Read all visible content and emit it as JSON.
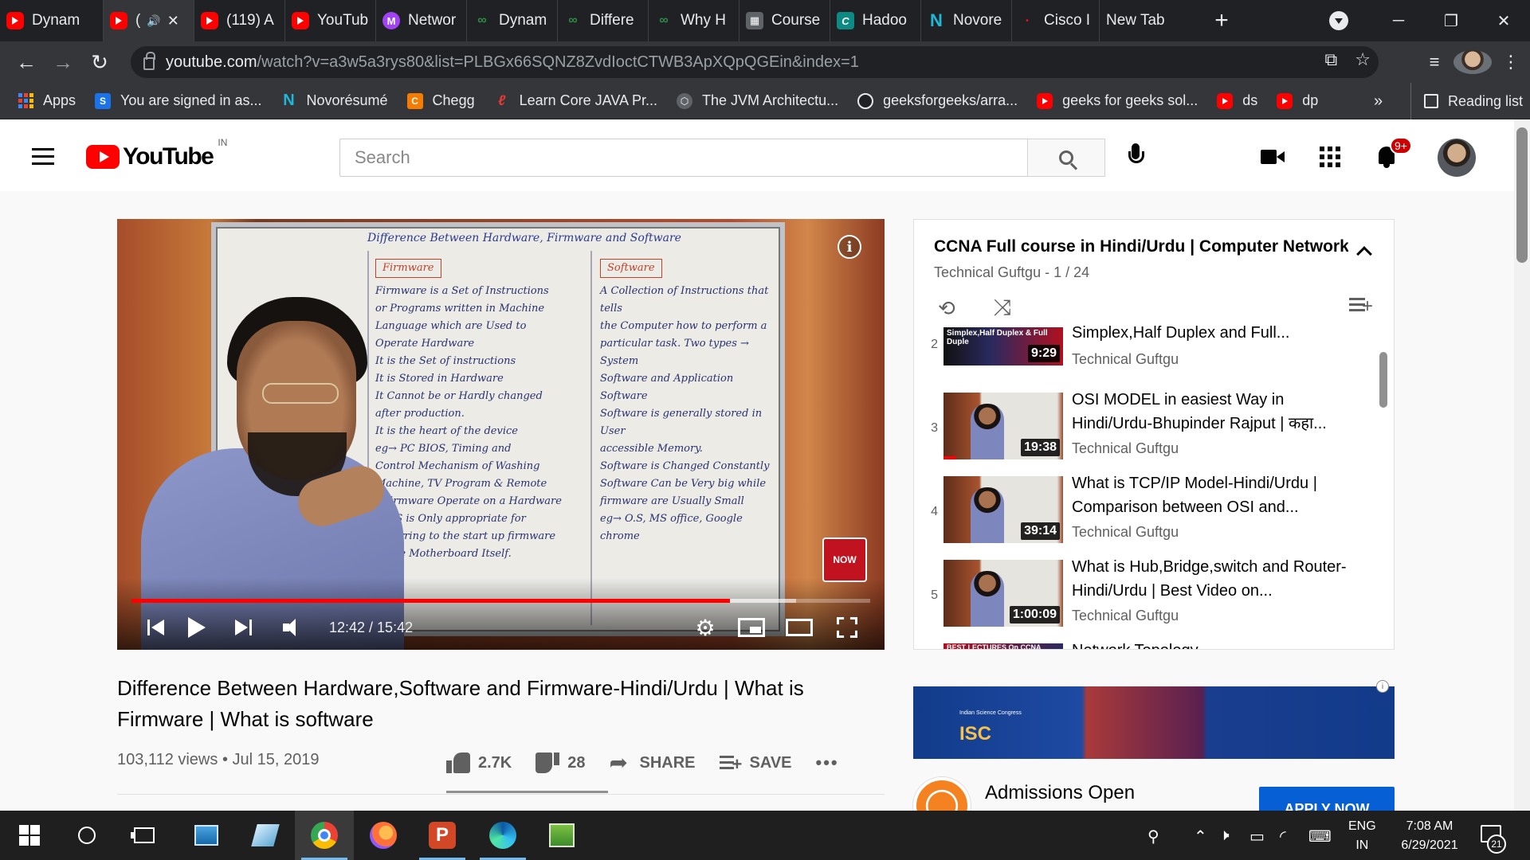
{
  "browser": {
    "tabs": [
      {
        "label": "Dynam",
        "icon": "youtube-icon"
      },
      {
        "label": "(",
        "icon": "youtube-icon",
        "active": true,
        "audio": "audio-icon"
      },
      {
        "label": "(119) A",
        "icon": "youtube-icon"
      },
      {
        "label": "YouTub",
        "icon": "youtube-icon"
      },
      {
        "label": "Networ",
        "icon": "mathpix-icon"
      },
      {
        "label": "Dynam",
        "icon": "gfg-icon"
      },
      {
        "label": "Differe",
        "icon": "gfg-icon"
      },
      {
        "label": "Why H",
        "icon": "gfg-icon"
      },
      {
        "label": "Course",
        "icon": "course-icon"
      },
      {
        "label": "Hadoo",
        "icon": "chegg-icon"
      },
      {
        "label": "Novore",
        "icon": "novoresume-icon"
      },
      {
        "label": "Cisco I",
        "icon": "cisco-icon"
      },
      {
        "label": "New Tab",
        "icon": ""
      }
    ],
    "url_host": "youtube.com",
    "url_path": "/watch?v=a3w5a3rys80&list=PLBGx66SQNZ8ZvdIoctCTWB3ApXQpQGEin&index=1",
    "bookmarks": [
      {
        "label": "Apps",
        "icon": "apps-icon"
      },
      {
        "label": "You are signed in as...",
        "icon": "s-icon"
      },
      {
        "label": "Novorésumé",
        "icon": "novoresume-icon"
      },
      {
        "label": "Chegg",
        "icon": "chegg-icon"
      },
      {
        "label": "Learn Core JAVA Pr...",
        "icon": "learn-java-icon"
      },
      {
        "label": "The JVM Architectu...",
        "icon": "jvm-icon"
      },
      {
        "label": "geeksforgeeks/arra...",
        "icon": "github-icon"
      },
      {
        "label": "geeks for geeks sol...",
        "icon": "youtube-icon"
      },
      {
        "label": "ds",
        "icon": "youtube-icon"
      },
      {
        "label": "dp",
        "icon": "youtube-icon"
      }
    ],
    "bookmarks_more": "»",
    "reading_list": "Reading list"
  },
  "youtube": {
    "logo_text": "YouTube",
    "region": "IN",
    "search_placeholder": "Search",
    "notification_count": "9+",
    "player": {
      "time": "12:42 / 15:42",
      "progress_fraction": 0.81,
      "buffered_fraction": 0.9,
      "info_glyph": "i",
      "subscribe_badge": "NOW",
      "whiteboard": {
        "title": "Difference Between Hardware, Firmware and Software",
        "firmware_heading": "Firmware",
        "software_heading": "Software",
        "firmware_lines": [
          "Firmware is a Set of Instructions",
          "or Programs written in Machine",
          "Language which are Used to",
          "Operate Hardware",
          "It is the Set of instructions",
          "It is Stored in Hardware",
          "It Cannot be or Hardly changed",
          "after production.",
          "It is the heart of the device",
          "eg→ PC BIOS, Timing and",
          "Control Mechanism of Washing",
          "Machine, TV Program & Remote",
          "A firmware Operate on a Hardware",
          "BIOS is Only appropriate for",
          "Referring to the start up firmware",
          "of the Motherboard Itself."
        ],
        "software_lines": [
          "A Collection of Instructions that tells",
          "the Computer how to perform a",
          "particular task. Two types → System",
          "Software and Application Software",
          "Software is generally stored in User",
          "accessible Memory.",
          "Software is Changed Constantly",
          "Software Can be Very big while",
          "firmware are Usually Small",
          "eg→ O.S, MS office, Google chrome"
        ]
      }
    },
    "video": {
      "title": "Difference Between Hardware,Software and Firmware-Hindi/Urdu | What is Firmware | What is software",
      "views": "103,112 views",
      "date": "Jul 15, 2019",
      "likes": "2.7K",
      "dislikes": "28",
      "share": "SHARE",
      "save": "SAVE",
      "more": "•••"
    },
    "playlist": {
      "title": "CCNA Full course in Hindi/Urdu | Computer Networking",
      "channel": "Technical Guftgu",
      "position": "1 / 24",
      "items": [
        {
          "index": "2",
          "title": "Simplex,Half Duplex and Full...",
          "channel": "Technical Guftgu",
          "duration": "9:29",
          "thumb_text": "Simplex,Half Duplex & Full Duple"
        },
        {
          "index": "3",
          "title": "OSI MODEL in easiest Way in Hindi/Urdu-Bhupinder Rajput | कहा...",
          "channel": "Technical Guftgu",
          "duration": "19:38",
          "watched": true
        },
        {
          "index": "4",
          "title": "What is TCP/IP Model-Hindi/Urdu | Comparison between OSI and...",
          "channel": "Technical Guftgu",
          "duration": "39:14"
        },
        {
          "index": "5",
          "title": "What is Hub,Bridge,switch and Router-Hindi/Urdu | Best Video on...",
          "channel": "Technical Guftgu",
          "duration": "1:00:09"
        },
        {
          "index": "",
          "title": "Network Topology-",
          "channel": "",
          "duration": "",
          "thumb_text": "BEST LECTURES On CCNA"
        }
      ]
    },
    "ad": {
      "banner_isc": "ISC",
      "banner_isc_sub": "Indian Science Congress",
      "headline": "Admissions Open",
      "cta": "APPLY NOW",
      "info_glyph": "i"
    }
  },
  "taskbar": {
    "lang_top": "ENG",
    "lang_bottom": "IN",
    "time": "7:08 AM",
    "date": "6/29/2021",
    "notification_count": "21"
  }
}
